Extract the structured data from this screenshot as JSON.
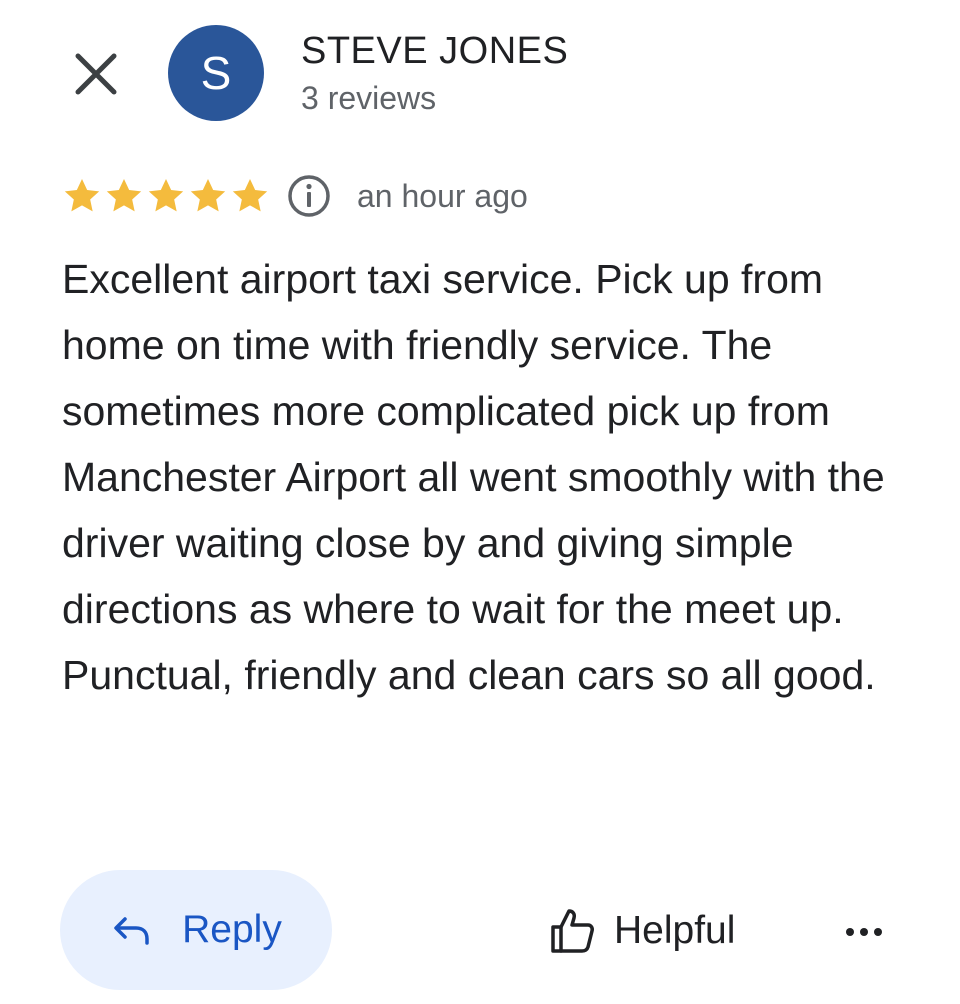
{
  "header": {
    "close_icon": "close-icon",
    "avatar_initial": "S",
    "avatar_color": "#2a5699",
    "author_name": "STEVE JONES",
    "review_count": "3 reviews"
  },
  "rating": {
    "stars": 5,
    "max_stars": 5,
    "star_color": "#f4bb3d",
    "info_icon": "info-icon",
    "timestamp": "an hour ago"
  },
  "review": {
    "text": "Excellent airport taxi service. Pick up from home on time with friendly service. The sometimes more complicated pick up from Manchester Airport all went smoothly with the driver waiting close by and giving simple directions as where to wait for the meet up. Punctual, friendly and clean cars so all good."
  },
  "actions": {
    "reply_label": "Reply",
    "reply_icon": "reply-arrow-icon",
    "helpful_label": "Helpful",
    "helpful_icon": "thumbs-up-icon",
    "more_icon": "more-horizontal-icon",
    "accent_color": "#1a56c4",
    "reply_bg_color": "#e8f0fe"
  }
}
